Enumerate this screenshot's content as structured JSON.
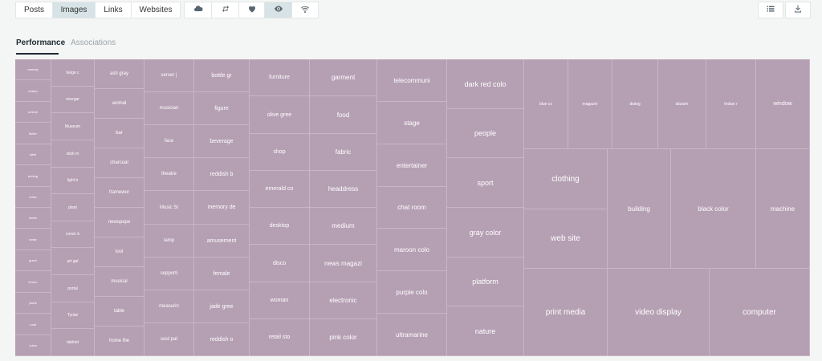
{
  "tabs": {
    "posts": "Posts",
    "images": "Images",
    "links": "Links",
    "websites": "Websites"
  },
  "icons": {
    "filters": [
      "cloud-icon",
      "repost-icon",
      "heart-icon",
      "eye-icon",
      "wifi-icon"
    ],
    "active_filter": "eye-icon",
    "right": [
      "list-icon",
      "download-icon"
    ]
  },
  "subtabs": {
    "performance": "Performance",
    "associations": "Associations"
  },
  "colors": {
    "treemap_fill": "#b59fb3",
    "active_tab": "#d7e3e6",
    "page_bg": "#f4f5f5"
  },
  "treemap": {
    "columns": [
      [
        "remedy",
        "turban",
        "umbrel",
        "flutter",
        "label",
        "photog",
        "relics",
        "shells",
        "smile",
        "guest",
        "lemon",
        "plank",
        "road",
        "colos"
      ],
      [
        "beige c",
        "overgar",
        "Museum",
        "slick m",
        "light b",
        "plant",
        "comic b",
        "art gal",
        "portal",
        "Tyrian",
        "tabloid"
      ],
      [
        "ash gray",
        "animal",
        "bar",
        "charcoal",
        "framewor",
        "newspape",
        "tool",
        "musical",
        "table",
        "home the"
      ],
      [
        "server |",
        "musician",
        "face",
        "theatre",
        "Music St",
        "lamp",
        "supporti",
        "measurin",
        "soul pat"
      ],
      [
        "bottle gr",
        "figure",
        "beverage",
        "reddish b",
        "memory de",
        "amusement",
        "female",
        "jade gree",
        "reddish o"
      ],
      [
        "furniture",
        "olive gree",
        "shop",
        "emerald co",
        "desktop",
        "disco",
        "woman",
        "retail sto"
      ],
      [
        "garment",
        "food",
        "fabric",
        "headdress",
        "medium",
        "news magazi",
        "electronic",
        "pink color"
      ],
      [
        "telecommuni",
        "stage",
        "entertainer",
        "chat room",
        "maroon colo",
        "purple colo",
        "ultramarine"
      ],
      [
        "dark red colo",
        "people",
        "sport",
        "gray color",
        "platform",
        "nature"
      ]
    ],
    "top_row": [
      "blue co",
      "magazin",
      "dialog",
      "alizarin",
      "Indian r",
      "window"
    ],
    "middle_left": [
      "clothing",
      "web site"
    ],
    "middle_right": [
      "building",
      "black color",
      "machine"
    ],
    "bottom_row": [
      "print media",
      "video display",
      "computer"
    ]
  }
}
